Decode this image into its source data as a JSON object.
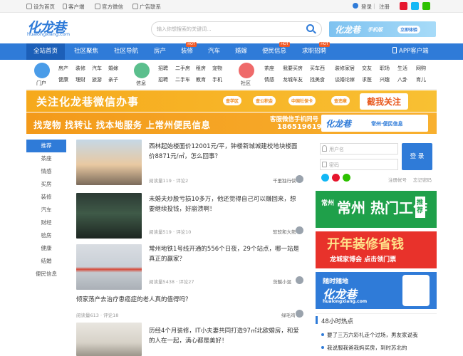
{
  "topbar": {
    "home": "设为首页",
    "client": "客户端",
    "wechat": "官方微信",
    "ad_contact": "广告联系",
    "login": "登录",
    "register": "注册"
  },
  "header": {
    "logo": "化龙巷",
    "logo_sub": "hualongxiang.com",
    "search_placeholder": "输入你想搜索的关键词...",
    "banner_text": "化龙巷",
    "banner_sub": "手机版",
    "banner_btn": "立即体验"
  },
  "nav": {
    "items": [
      "全站首页",
      "社区聚焦",
      "社区导航",
      "房产",
      "装修",
      "汽车",
      "婚嫁",
      "便民信息",
      "求职招聘"
    ],
    "hot_label": "HOT",
    "app": "APP客户端"
  },
  "categories": {
    "portal": {
      "label": "门户",
      "links": [
        "房产",
        "装修",
        "汽车",
        "婚嫁",
        "健康",
        "理财",
        "旅游",
        "亲子"
      ]
    },
    "info": {
      "label": "信息",
      "links": [
        "招聘",
        "二手房",
        "租房",
        "宠物",
        "招聘",
        "二手车",
        "教育",
        "手机"
      ]
    },
    "community": {
      "label": "社区",
      "links": [
        "茶座",
        "我要买房",
        "买车西",
        "装修家居",
        "交友",
        "职场",
        "生活",
        "网购",
        "情感",
        "龙城车友",
        "找美食",
        "谈婚论嫁",
        "求医",
        "兴趣",
        "八卦",
        "育儿"
      ]
    }
  },
  "ads": {
    "ad1_main": "关注化龙巷微信办事",
    "ad1_tags": [
      "查学区",
      "查公积金",
      "中国社保卡",
      "查违章"
    ],
    "ad1_btn": "截我关注",
    "ad2_main": "找宠物 找转让 找本地服务 上常州便民信息",
    "ad2_phone_label": "客服微信手机同号",
    "ad2_phone": "18651961961",
    "ad2_logo": "化龙巷",
    "ad2_logo_sub": "常州·便民信息"
  },
  "left_menu": [
    "推荐",
    "茶座",
    "情感",
    "买房",
    "装修",
    "汽车",
    "财经",
    "验房",
    "健康",
    "结婚",
    "便民信息"
  ],
  "news": [
    {
      "title": "西林起始楼面价12001元/平，钟楼新城城建校地块楼面价8871元/㎡，怎么回事？",
      "meta": "阅读量119 · 评论2",
      "author": "千里独行侠"
    },
    {
      "title": "未婚夫炒股亏损10多万，他还觉得自己可以赚回来，想要继续投钱，好崩溃啊！",
      "meta": "阅读量519 · 评论10",
      "author": "软软和大熊"
    },
    {
      "title": "常州地铁1号线开通的556个日夜，29个站点，哪一站是真正的赢家？",
      "meta": "阅读量5438 · 评论27",
      "author": "茨魆小混"
    },
    {
      "title": "倾家荡产去治疗患癌症的老人真的值得吗？",
      "meta": "阅读量613 · 评论18",
      "author": "绿毛鸡"
    },
    {
      "title": "历经4个月装修，IT小夫妻共同打造97㎡北欧婚房，和爱的人在一起，满心都是美好！",
      "meta": "",
      "author": ""
    }
  ],
  "login": {
    "user_ph": "用户名",
    "pass_ph": "密码",
    "login_btn": "登 录",
    "register": "注册帐号",
    "forgot": "忘记密码"
  },
  "side_ads": {
    "ad1": "常州 热门工作",
    "ad1_tag": "推荐",
    "ad2": "开年装修省钱",
    "ad2_sub": "龙城家博会 点击领门票",
    "ad3": "随时随地",
    "ad3_logo": "化龙巷",
    "ad3_sub": "hualongxiang.com"
  },
  "hot48": {
    "title": "48小时热点",
    "items": [
      "要了三万六彩礼走个过场，男友家说我",
      "我说服我爸我妈买房，到时苏北的"
    ]
  },
  "colors": {
    "primary": "#2f7bd8",
    "accent": "#f05a28",
    "ad_orange": "#f6a91c"
  }
}
